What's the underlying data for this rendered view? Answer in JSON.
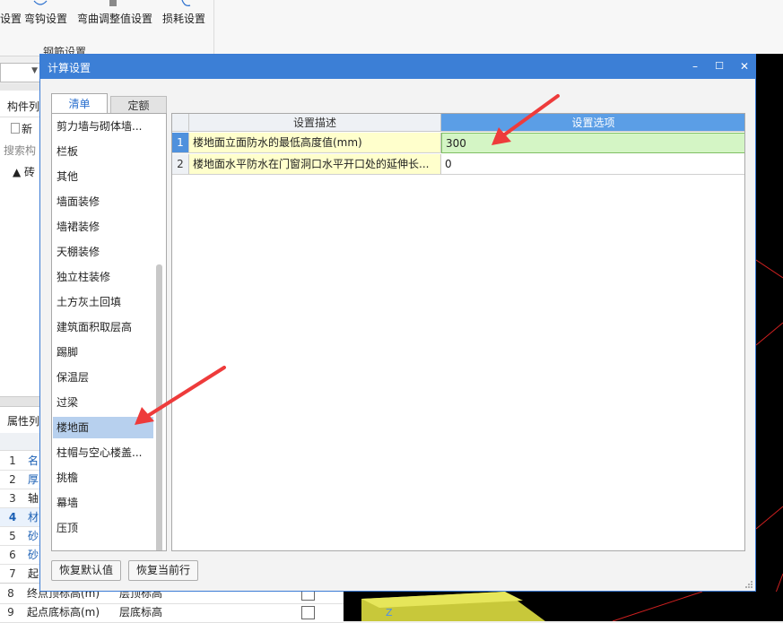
{
  "ribbon": {
    "buttons": [
      "设置",
      "弯钩设置",
      "弯曲调整值设置",
      "损耗设置"
    ],
    "group_label": "钢筋设置"
  },
  "left_panel": {
    "component_list_title": "构件列",
    "new_label": "新",
    "search_placeholder": "搜索构",
    "tree_root": "▲ 砖",
    "props_title": "属性列",
    "rows": [
      {
        "num": "1",
        "text": "名"
      },
      {
        "num": "2",
        "text": "厚"
      },
      {
        "num": "3",
        "text": "轴"
      },
      {
        "num": "4",
        "text": "材"
      },
      {
        "num": "5",
        "text": "砂"
      },
      {
        "num": "6",
        "text": "砂"
      },
      {
        "num": "7",
        "text": "起"
      }
    ]
  },
  "bottom_grid": {
    "rows": [
      {
        "num": "8",
        "name": "终点顶标高(m)",
        "value": "层顶标高"
      },
      {
        "num": "9",
        "name": "起点底标高(m)",
        "value": "层底标高"
      }
    ]
  },
  "dialog": {
    "title": "计算设置",
    "controls": {
      "minimize": "–",
      "maximize": "☐",
      "close": "✕"
    },
    "tabs": [
      {
        "label": "清单",
        "active": true
      },
      {
        "label": "定额",
        "active": false
      }
    ],
    "list": {
      "items": [
        "剪力墙与砌体墙...",
        "栏板",
        "其他",
        "墙面装修",
        "墙裙装修",
        "天棚装修",
        "独立柱装修",
        "土方灰土回填",
        "建筑面积取层高",
        "踢脚",
        "保温层",
        "过梁",
        "楼地面",
        "柱帽与空心楼盖...",
        "挑檐",
        "幕墙",
        "压顶"
      ],
      "selected": "楼地面"
    },
    "grid": {
      "columns": [
        "设置描述",
        "设置选项"
      ],
      "rows": [
        {
          "num": "1",
          "desc": "楼地面立面防水的最低高度值(mm)",
          "value": "300"
        },
        {
          "num": "2",
          "desc": "楼地面水平防水在门窗洞口水平开口处的延伸长...",
          "value": "0"
        }
      ],
      "selected_row": "1"
    },
    "buttons": {
      "restore_default": "恢复默认值",
      "restore_row": "恢复当前行"
    }
  },
  "colors": {
    "title_bar": "#3c7fd6",
    "header_selected": "#5b9ee6",
    "cell_selected": "#d4f5c5",
    "desc_cell": "#ffffcc",
    "list_selected": "#b7d0ee",
    "annotation_arrow": "#ee3b3b"
  }
}
